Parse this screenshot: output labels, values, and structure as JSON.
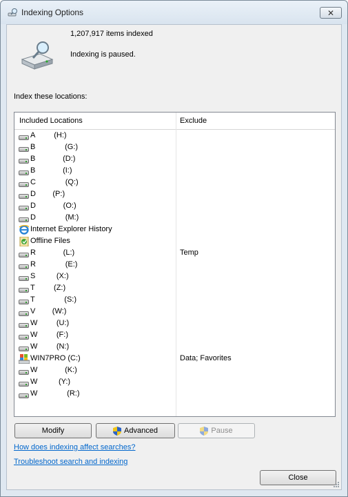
{
  "window": {
    "title": "Indexing Options"
  },
  "summary": {
    "items_indexed": "1,207,917 items indexed",
    "status": "Indexing is paused."
  },
  "locations": {
    "heading": "Index these locations:",
    "columns": {
      "included": "Included Locations",
      "exclude": "Exclude"
    },
    "rows": [
      {
        "icon": "drive-icon",
        "name": "A         (H:)",
        "exclude": ""
      },
      {
        "icon": "drive-icon",
        "name": "B              (G:)",
        "exclude": ""
      },
      {
        "icon": "drive-icon",
        "name": "B             (D:)",
        "exclude": ""
      },
      {
        "icon": "drive-icon",
        "name": "B             (I:)",
        "exclude": ""
      },
      {
        "icon": "drive-icon",
        "name": "C              (Q:)",
        "exclude": ""
      },
      {
        "icon": "drive-icon",
        "name": "D        (P:)",
        "exclude": ""
      },
      {
        "icon": "drive-icon",
        "name": "D             (O:)",
        "exclude": ""
      },
      {
        "icon": "drive-icon",
        "name": "D              (M:)",
        "exclude": ""
      },
      {
        "icon": "ie-icon",
        "name": "Internet Explorer History",
        "exclude": ""
      },
      {
        "icon": "offline-files-icon",
        "name": "Offline Files",
        "exclude": ""
      },
      {
        "icon": "drive-icon",
        "name": "R             (L:)",
        "exclude": "Temp"
      },
      {
        "icon": "drive-icon",
        "name": "R              (E:)",
        "exclude": ""
      },
      {
        "icon": "drive-icon",
        "name": "S          (X:)",
        "exclude": ""
      },
      {
        "icon": "drive-icon",
        "name": "T         (Z:)",
        "exclude": ""
      },
      {
        "icon": "drive-icon",
        "name": "T              (S:)",
        "exclude": ""
      },
      {
        "icon": "drive-icon",
        "name": "V        (W:)",
        "exclude": ""
      },
      {
        "icon": "drive-icon",
        "name": "W         (U:)",
        "exclude": ""
      },
      {
        "icon": "drive-icon",
        "name": "W         (F:)",
        "exclude": ""
      },
      {
        "icon": "drive-icon",
        "name": "W         (N:)",
        "exclude": ""
      },
      {
        "icon": "windows-drive-icon",
        "name": "WIN7PRO (C:)",
        "exclude": "Data; Favorites"
      },
      {
        "icon": "drive-icon",
        "name": "W             (K:)",
        "exclude": ""
      },
      {
        "icon": "drive-icon",
        "name": "W          (Y:)",
        "exclude": ""
      },
      {
        "icon": "drive-icon",
        "name": "W              (R:)",
        "exclude": ""
      }
    ]
  },
  "buttons": {
    "modify": "Modify",
    "advanced": "Advanced",
    "pause": "Pause",
    "close": "Close"
  },
  "links": {
    "affect": "How does indexing affect searches?",
    "troubleshoot": "Troubleshoot search and indexing"
  }
}
